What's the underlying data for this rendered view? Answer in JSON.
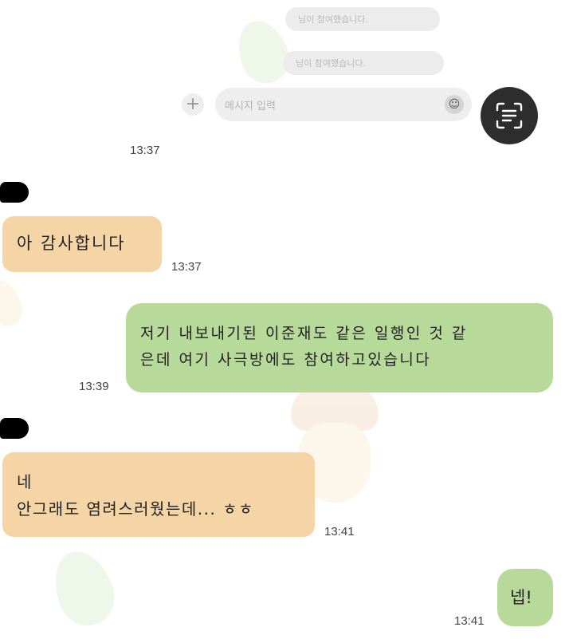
{
  "background_watermarks": [
    {
      "icon": "leaf-icon"
    },
    {
      "icon": "acorn-icon"
    },
    {
      "icon": "leaf-icon"
    }
  ],
  "system_messages": [
    {
      "text": "님이 참여했습니다."
    },
    {
      "text": "님이 참여했습니다."
    }
  ],
  "composer": {
    "plus_icon": "+",
    "placeholder": "메시지 입력",
    "emoji_icon": "☺"
  },
  "scan_button": {
    "icon": "text-scan-icon"
  },
  "messages": [
    {
      "side": "received",
      "text_lines": [
        "아 감사합니다"
      ],
      "time": "13:37"
    },
    {
      "side": "sent",
      "text_lines": [
        "저기 내보내기된 이준재도 같은 일행인 것 같",
        "은데 여기 사극방에도 참여하고있습니다"
      ],
      "time": "13:39"
    },
    {
      "side": "received",
      "text_lines": [
        "네",
        "안그래도 염려스러웠는데... ㅎㅎ"
      ],
      "time": "13:41"
    },
    {
      "side": "sent",
      "text_lines": [
        "넵!"
      ],
      "time": "13:41"
    }
  ],
  "top_time": "13:37",
  "colors": {
    "received_bubble": "#f5d4a5",
    "sent_bubble": "#b7d99a",
    "scan_button_bg": "#2d2d2d"
  }
}
